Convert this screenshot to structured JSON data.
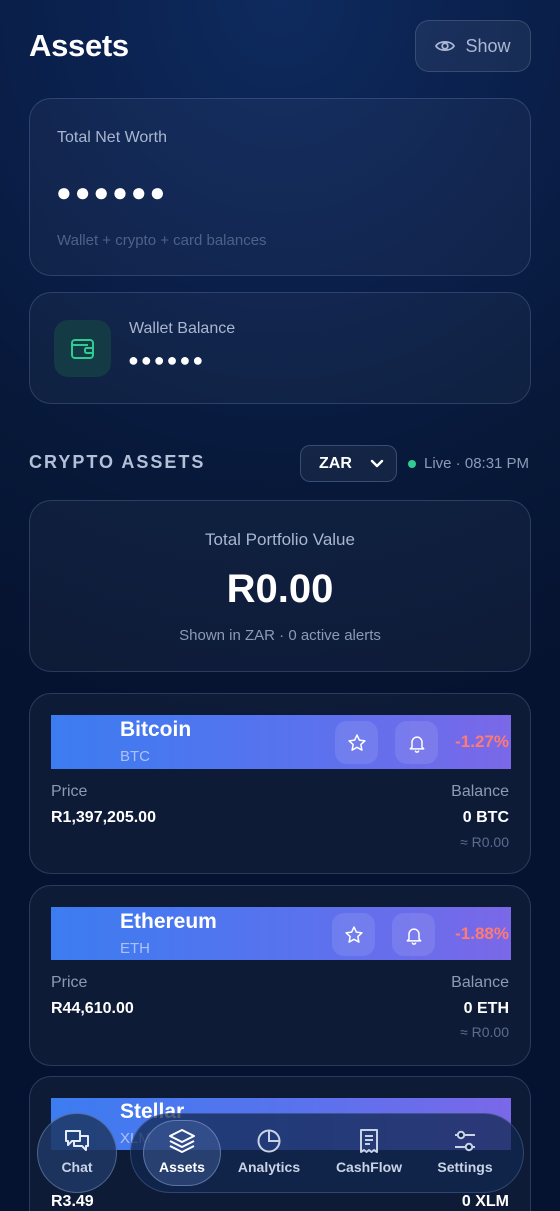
{
  "header": {
    "title": "Assets",
    "show_label": "Show",
    "show_icon": "eye-icon"
  },
  "net_worth": {
    "label": "Total Net Worth",
    "value": "●●●●●●",
    "subtitle": "Wallet + crypto + card balances"
  },
  "wallet": {
    "label": "Wallet Balance",
    "value": "●●●●●●",
    "icon": "wallet-icon"
  },
  "crypto": {
    "section_title": "CRYPTO ASSETS",
    "currency": "ZAR",
    "status": "Live · 08:31 PM",
    "status_color": "#2ecc91",
    "portfolio": {
      "label": "Total Portfolio Value",
      "value": "R0.00",
      "subtitle": "Shown in ZAR · 0 active alerts"
    },
    "price_label": "Price",
    "balance_label": "Balance",
    "coins": [
      {
        "name": "Bitcoin",
        "symbol": "BTC",
        "change": "-1.27%",
        "price": "R1,397,205.00",
        "balance": "0 BTC",
        "balance_zar": "≈ R0.00"
      },
      {
        "name": "Ethereum",
        "symbol": "ETH",
        "change": "-1.88%",
        "price": "R44,610.00",
        "balance": "0 ETH",
        "balance_zar": "≈ R0.00"
      },
      {
        "name": "Stellar",
        "symbol": "XLM",
        "change": "",
        "price": "R3.49",
        "balance": "0 XLM",
        "balance_zar": ""
      }
    ]
  },
  "nav": {
    "chat": "Chat",
    "items": [
      {
        "label": "Assets",
        "icon": "layers-icon",
        "active": true
      },
      {
        "label": "Analytics",
        "icon": "pie-chart-icon",
        "active": false
      },
      {
        "label": "CashFlow",
        "icon": "receipt-icon",
        "active": false
      },
      {
        "label": "Settings",
        "icon": "sliders-icon",
        "active": false
      }
    ]
  },
  "colors": {
    "accent": "#3c7cf1",
    "negative": "#ff7a73",
    "positive": "#2ecc91"
  }
}
